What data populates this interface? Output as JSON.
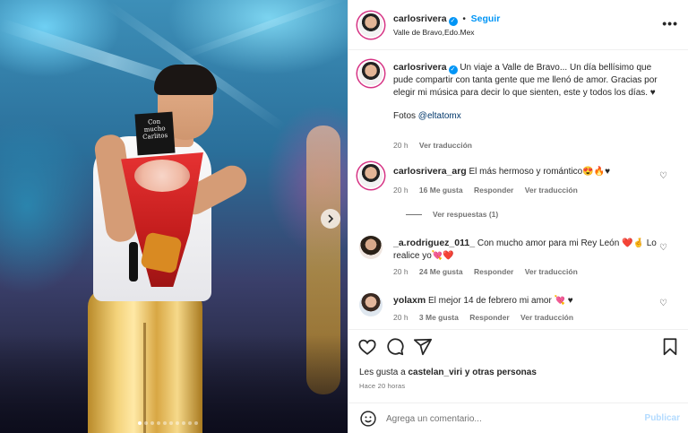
{
  "post": {
    "author": "carlosrivera",
    "follow_label": "Seguir",
    "location": "Valle de Bravo,Edo.Mex",
    "more_label": "•••",
    "photo_card_text": "Con mucho Carlitos",
    "carousel_dots": 10,
    "caption": {
      "username": "carlosrivera",
      "text": "Un viaje a Valle de Bravo... Un día bellísimo que pude compartir con tanta gente que me llenó de amor. Gracias por elegir mi música para decir lo que sienten, este y todos los días. ♥",
      "credits_prefix": "Fotos ",
      "credits_mention": "@eltatomx",
      "time": "20 h",
      "translate": "Ver traducción"
    }
  },
  "comments": [
    {
      "username": "carlosrivera_arg",
      "text": "El más hermoso y romántico😍🔥♥",
      "time": "20 h",
      "likes": "16 Me gusta",
      "reply": "Responder",
      "translate": "Ver traducción",
      "view_replies": "Ver respuestas (1)"
    },
    {
      "username": "_a.rodriguez_011_",
      "text": "Con mucho amor para mi Rey León ❤️🤞 Lo realice yo💘❤️",
      "time": "20 h",
      "likes": "24 Me gusta",
      "reply": "Responder",
      "translate": "Ver traducción"
    },
    {
      "username": "yolaxm",
      "text": "El mejor 14 de febrero mi amor 💘 ♥",
      "time": "20 h",
      "likes": "3 Me gusta",
      "reply": "Responder",
      "translate": "Ver traducción"
    }
  ],
  "footer": {
    "likes_prefix": "Les gusta a ",
    "likes_user": "castelan_viri",
    "likes_suffix": " y otras personas",
    "time": "Hace 20 horas",
    "comment_placeholder": "Agrega un comentario...",
    "publish_label": "Publicar"
  },
  "colors": {
    "accent": "#0095f6",
    "muted": "#737373",
    "publish_disabled": "#b3dbff"
  },
  "icons": [
    "verified-badge-icon",
    "more-icon",
    "heart-icon",
    "comment-icon",
    "share-icon",
    "bookmark-icon",
    "emoji-icon",
    "chevron-right-icon"
  ]
}
